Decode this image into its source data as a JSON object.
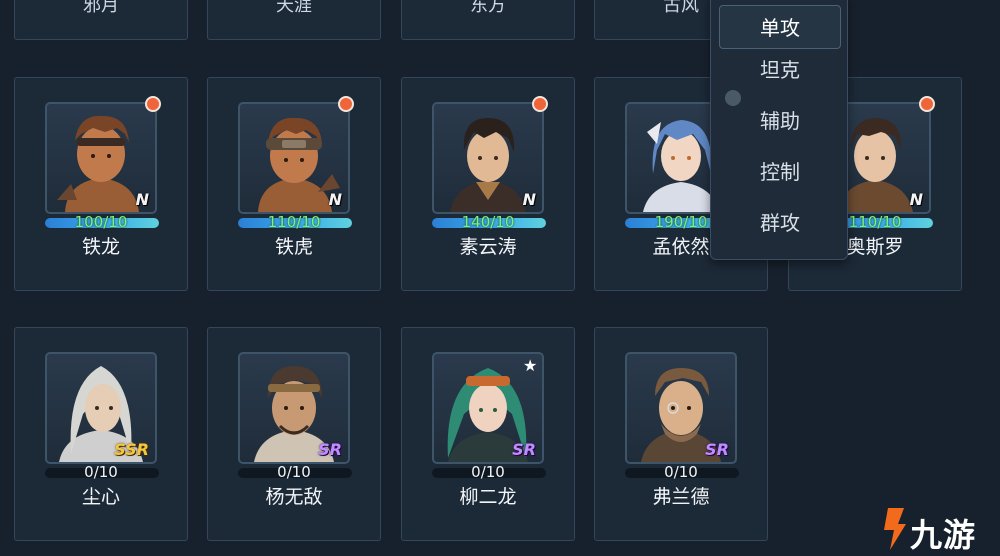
{
  "top_row": [
    {
      "name": "邪月"
    },
    {
      "name": "天涯"
    },
    {
      "name": "东方"
    },
    {
      "name": "古风"
    }
  ],
  "cards": [
    {
      "name": "铁龙",
      "progress": "100/10",
      "rarity": "N",
      "has_dot": true,
      "owned": true
    },
    {
      "name": "铁虎",
      "progress": "110/10",
      "rarity": "N",
      "has_dot": true,
      "owned": true
    },
    {
      "name": "素云涛",
      "progress": "140/10",
      "rarity": "N",
      "has_dot": true,
      "owned": true
    },
    {
      "name": "孟依然",
      "progress": "190/10",
      "rarity": "N",
      "has_dot": true,
      "owned": true
    },
    {
      "name": "奥斯罗",
      "progress": "110/10",
      "rarity": "N",
      "has_dot": true,
      "owned": true
    },
    {
      "name": "尘心",
      "progress": "0/10",
      "rarity": "SSR",
      "has_dot": false,
      "owned": false
    },
    {
      "name": "杨无敌",
      "progress": "0/10",
      "rarity": "SR",
      "has_dot": false,
      "owned": false
    },
    {
      "name": "柳二龙",
      "progress": "0/10",
      "rarity": "SR",
      "has_dot": false,
      "has_star": true,
      "owned": false
    },
    {
      "name": "弗兰德",
      "progress": "0/10",
      "rarity": "SR",
      "has_dot": false,
      "owned": false
    }
  ],
  "filter_menu": {
    "items": [
      "单攻",
      "坦克",
      "辅助",
      "控制",
      "群攻"
    ],
    "selected_index": 0
  },
  "watermark": {
    "text": "九游",
    "icon": "jiuyou-logo-icon"
  },
  "colors": {
    "accent_dot": "#f0643a",
    "progress_text": "#7ff07a",
    "ssr": "#f4c742",
    "sr": "#c28bff"
  },
  "symbols": {
    "star": "★"
  }
}
